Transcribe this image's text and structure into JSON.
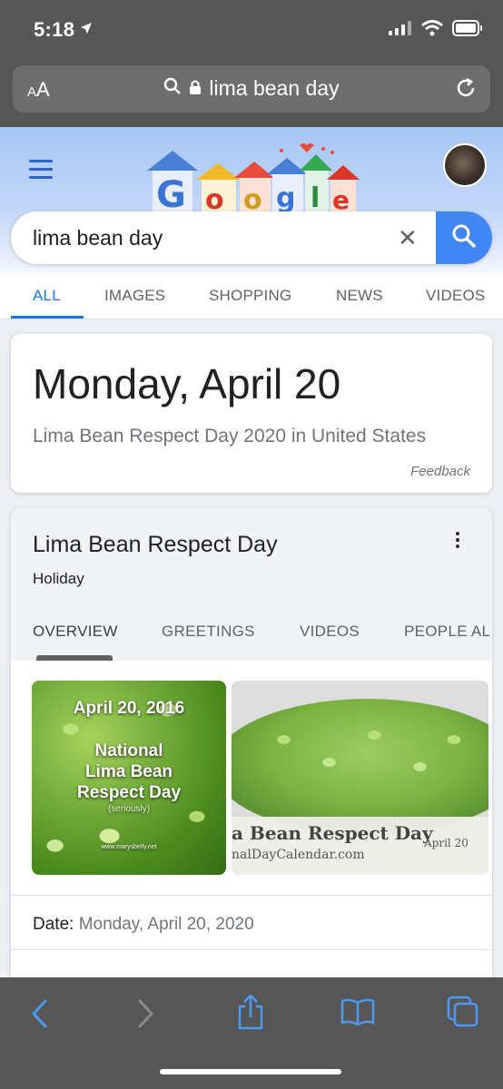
{
  "status_bar": {
    "time": "5:18"
  },
  "url_bar": {
    "aa_label": "AA",
    "url_text": "lima bean day"
  },
  "search": {
    "query": "lima bean day"
  },
  "tabs": [
    {
      "label": "ALL",
      "active": true
    },
    {
      "label": "IMAGES"
    },
    {
      "label": "SHOPPING"
    },
    {
      "label": "NEWS"
    },
    {
      "label": "VIDEOS"
    }
  ],
  "date_card": {
    "date": "Monday, April 20",
    "subtitle": "Lima Bean Respect Day 2020 in United States",
    "feedback": "Feedback"
  },
  "knowledge_panel": {
    "title": "Lima Bean Respect Day",
    "subtitle": "Holiday",
    "tabs": [
      "OVERVIEW",
      "GREETINGS",
      "VIDEOS",
      "PEOPLE AL"
    ],
    "image1": {
      "line1": "April 20, 2016",
      "line2": "National",
      "line3": "Lima Bean",
      "line4": "Respect Day",
      "line5": "(seriously)",
      "line6": "www.marysbelly.net"
    },
    "image2": {
      "line1": "a Bean Respect Day",
      "line2": "nalDayCalendar.com",
      "line3": "April 20"
    },
    "date_label": "Date:",
    "date_value": "Monday, April 20, 2020"
  },
  "colors": {
    "chrome": "#565656",
    "google_blue": "#4285f4",
    "link_blue": "#1a73e8"
  }
}
